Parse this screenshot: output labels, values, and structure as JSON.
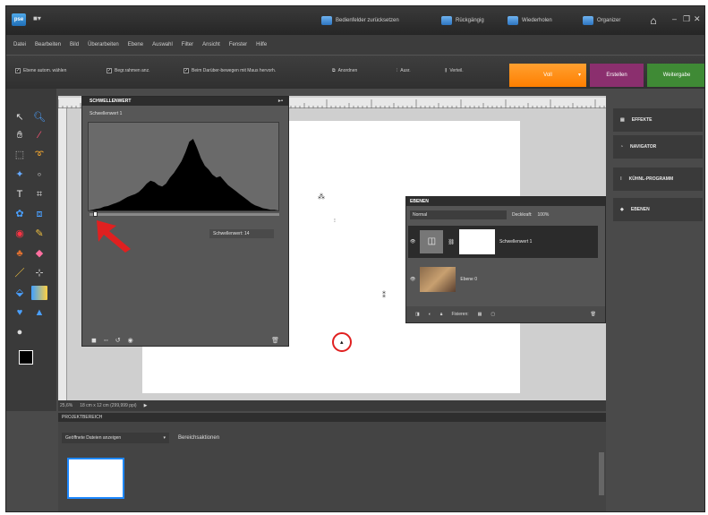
{
  "titlebar": {
    "logo": "pse",
    "workspace_icon": "■▾",
    "buttons": [
      {
        "label": "Bedienfelder zurücksetzen"
      },
      {
        "label": "Rückgängig"
      },
      {
        "label": "Wiederholen"
      },
      {
        "label": "Organizer"
      }
    ],
    "window_controls": [
      "–",
      "❐",
      "✕"
    ]
  },
  "menu": [
    "Datei",
    "Bearbeiten",
    "Bild",
    "Überarbeiten",
    "Ebene",
    "Auswahl",
    "Filter",
    "Ansicht",
    "Fenster",
    "Hilfe"
  ],
  "options": {
    "items": [
      {
        "label": "Ebene autom. wählen"
      },
      {
        "label": "Begr.rahmen anz."
      },
      {
        "label": "Beim Darüber-bewegen mit Maus hervorh."
      }
    ],
    "arrange": "Anordnen",
    "align": "Ausr.",
    "distribute": "Verteil."
  },
  "modes": {
    "full": "Voll",
    "create": "Erstellen",
    "share": "Weitergabe"
  },
  "threshold": {
    "title": "SCHWELLENWERT",
    "subtitle": "Schwellenwert 1",
    "value_label": "Schwellenwert: 14",
    "histogram": [
      0,
      1,
      2,
      3,
      5,
      6,
      8,
      10,
      12,
      15,
      18,
      20,
      22,
      25,
      30,
      36,
      40,
      38,
      34,
      32,
      36,
      44,
      50,
      58,
      66,
      78,
      92,
      96,
      84,
      70,
      60,
      55,
      48,
      44,
      46,
      40,
      34,
      30,
      26,
      22,
      18,
      14,
      10,
      7,
      5,
      3,
      2,
      1,
      1,
      0
    ]
  },
  "layers": {
    "title": "EBENEN",
    "blend_mode": "Normal",
    "opacity_label": "Deckkraft:",
    "opacity_value": "100%",
    "items": [
      {
        "name": "Schwellenwert 1"
      },
      {
        "name": "Ebene 0"
      }
    ],
    "lock_label": "Fixieren:"
  },
  "right_panels": [
    {
      "label": "EFFEKTE"
    },
    {
      "label": "NAVIGATOR"
    },
    {
      "label": "KÜHNL-PROGRAMM"
    },
    {
      "label": "EBENEN"
    }
  ],
  "status": {
    "zoom": "25,6%",
    "doc_info": "18 cm x 12 cm (299,999 ppi)"
  },
  "project_bin": {
    "title": "PROJEKTBEREICH",
    "filter": "Geöffnete Dateien anzeigen",
    "tab": "Bereichsaktionen"
  },
  "colors": {
    "accent_orange": "#ff7f00",
    "create_purple": "#8b2f6e",
    "share_green": "#3f8a35",
    "annotation_red": "#e02020"
  }
}
